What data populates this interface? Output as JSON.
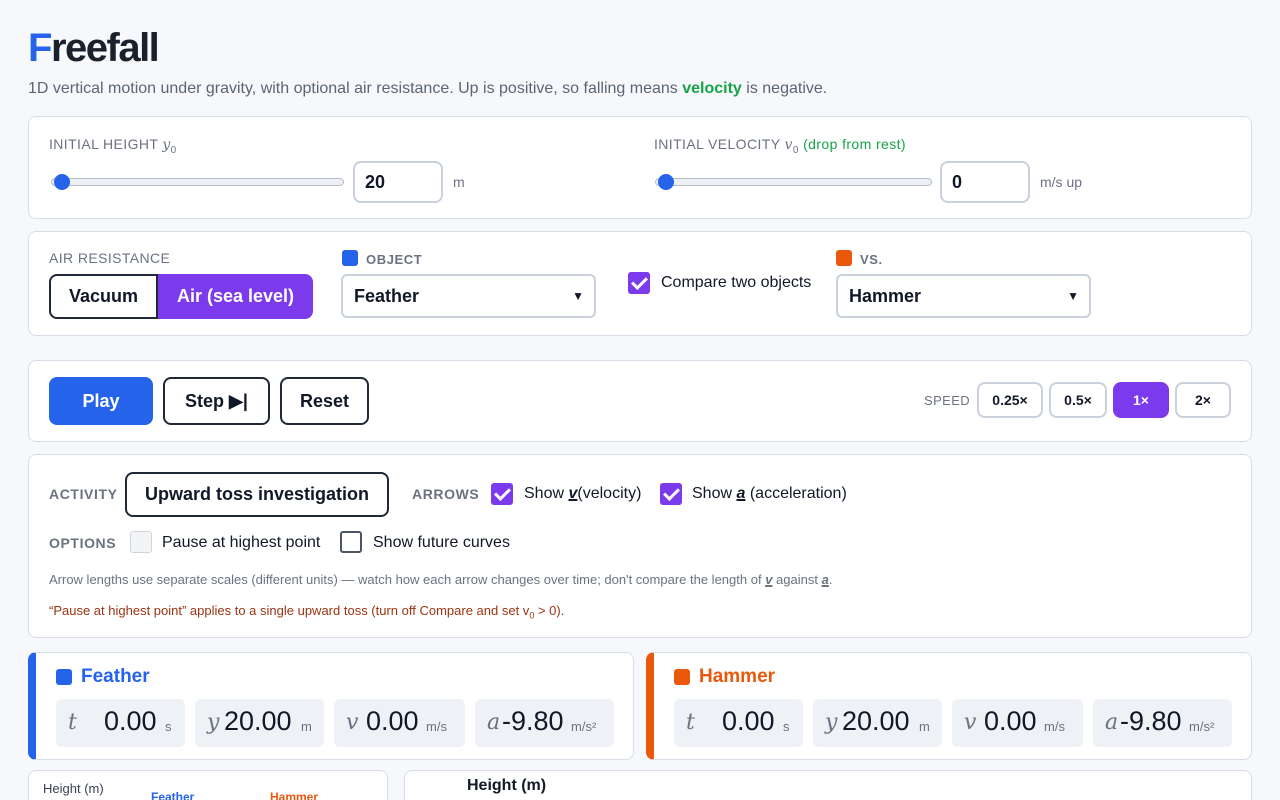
{
  "header": {
    "title_first": "F",
    "title_rest": "reefall",
    "subtitle_pre": "1D vertical motion under gravity, with optional air resistance. Up is positive, so falling means",
    "subtitle_hl": "velocity",
    "subtitle_post": "is negative."
  },
  "initial": {
    "height_label": "INITIAL HEIGHT",
    "height_sym": "y",
    "height_sub": "0",
    "height_value": "20",
    "height_unit": "m",
    "height_slider_fraction": 0,
    "velocity_label": "INITIAL VELOCITY",
    "velocity_sym": "v",
    "velocity_sub": "0",
    "velocity_note": "(drop from rest)",
    "velocity_value": "0",
    "velocity_unit": "m/s up",
    "velocity_slider_fraction": 0
  },
  "air": {
    "label": "AIR RESISTANCE",
    "vacuum": "Vacuum",
    "air": "Air (sea level)",
    "object_label": "OBJECT",
    "object_value": "Feather",
    "compare_label": "Compare two objects",
    "vs_label": "VS.",
    "vs_value": "Hammer"
  },
  "playback": {
    "play": "Play",
    "step": "Step ▶|",
    "reset": "Reset",
    "speed_label": "SPEED",
    "speeds": [
      "0.25×",
      "0.5×",
      "1×",
      "2×"
    ],
    "active_speed": "1×"
  },
  "activity": {
    "label": "ACTIVITY",
    "value": "Upward toss investigation",
    "arrows_label": "ARROWS",
    "show_v_pre": "Show",
    "show_v_sym": "v",
    "show_v_post": "(velocity)",
    "show_a_pre": "Show",
    "show_a_sym": "a",
    "show_a_post": "(acceleration)",
    "options_label": "OPTIONS",
    "pause_label": "Pause at highest point",
    "future_label": "Show future curves",
    "note1_pre": "Arrow lengths use separate scales (different units) — watch how each arrow changes over time; don't compare the length of",
    "note1_v": "v",
    "note1_mid": "against",
    "note1_a": "a",
    "note1_end": ".",
    "note2_pre": "“Pause at highest point” applies to a single upward toss (turn off Compare and set v",
    "note2_sub": "0",
    "note2_post": "> 0)."
  },
  "objects": [
    {
      "name": "Feather",
      "color": "#2563eb",
      "t": "0.00",
      "t_unit": "s",
      "y": "20.00",
      "y_unit": "m",
      "v": "0.00",
      "v_unit": "m/s",
      "a": "-9.80",
      "a_unit": "m/s²"
    },
    {
      "name": "Hammer",
      "color": "#ea580c",
      "t": "0.00",
      "t_unit": "s",
      "y": "20.00",
      "y_unit": "m",
      "v": "0.00",
      "v_unit": "m/s",
      "a": "-9.80",
      "a_unit": "m/s²"
    }
  ],
  "bottom": {
    "left_label": "Height (m)",
    "left_feather": "Feather",
    "left_hammer": "Hammer",
    "right_title": "Height (m)"
  }
}
